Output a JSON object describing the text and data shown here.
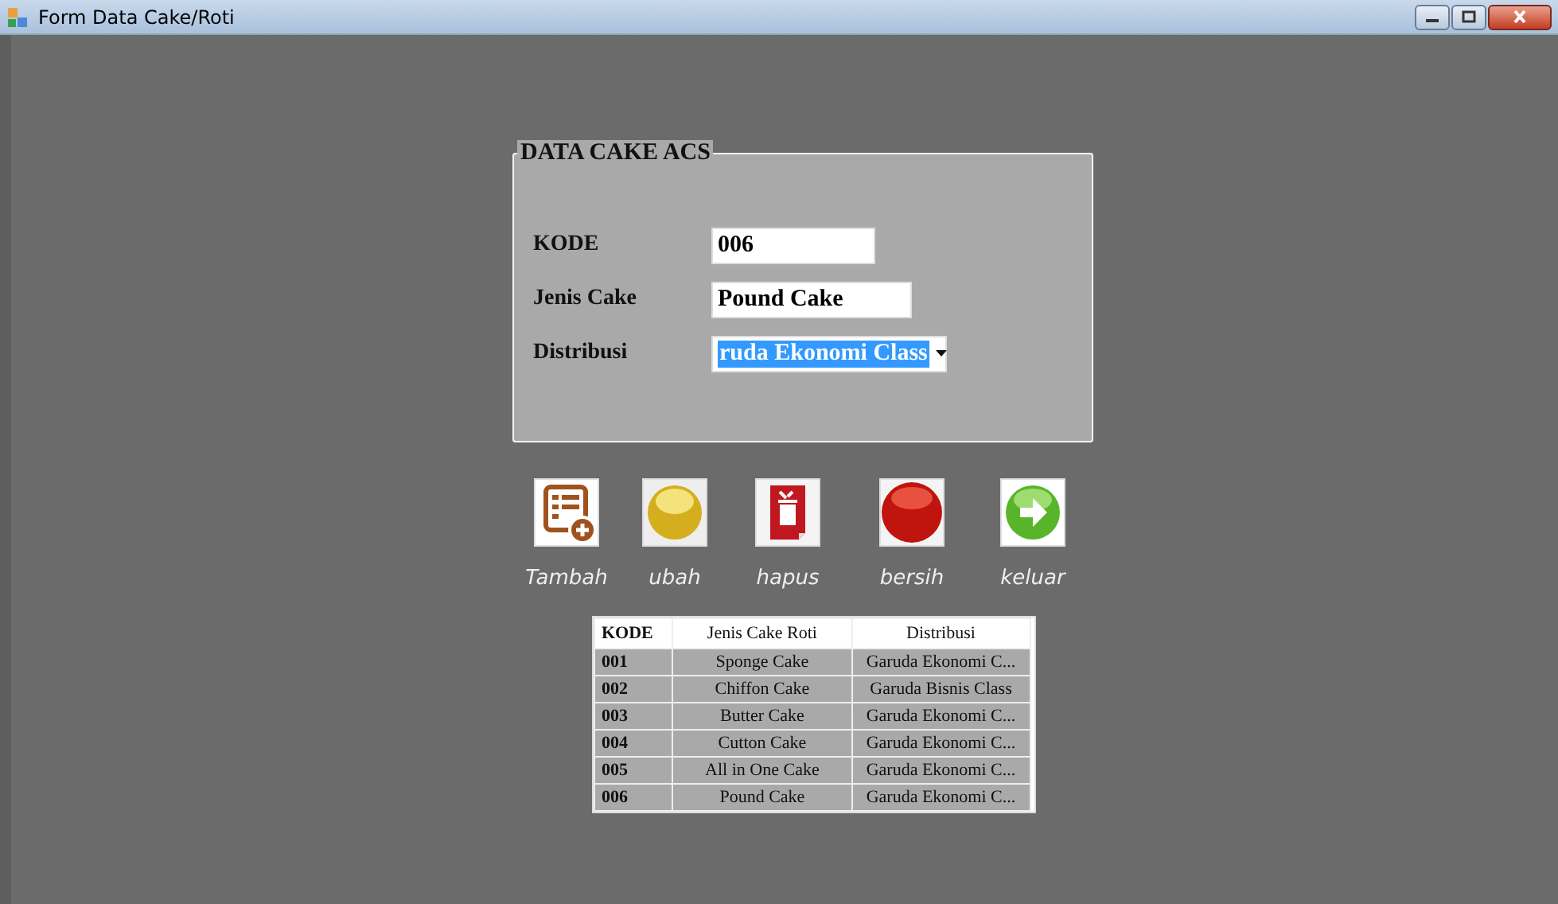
{
  "window": {
    "title": "Form Data Cake/Roti"
  },
  "form": {
    "title": "DATA CAKE ACS",
    "fields": [
      {
        "label": "KODE",
        "kind": "text",
        "value": "006"
      },
      {
        "label": "Jenis Cake",
        "kind": "text",
        "value": "Pound Cake"
      },
      {
        "label": "Distribusi",
        "kind": "dropdown",
        "value": "ruda Ekonomi Class",
        "selected": true
      }
    ]
  },
  "buttons": [
    {
      "label": "Tambah",
      "kind": "add"
    },
    {
      "label": "ubah",
      "kind": "edit"
    },
    {
      "label": "hapus",
      "kind": "delete"
    },
    {
      "label": "bersih",
      "kind": "clear"
    },
    {
      "label": "keluar",
      "kind": "exit"
    }
  ],
  "table": {
    "columns": [
      "KODE",
      "Jenis Cake Roti",
      "Distribusi"
    ],
    "rows": [
      [
        "001",
        "Sponge Cake",
        "Garuda Ekonomi C..."
      ],
      [
        "002",
        "Chiffon Cake",
        "Garuda Bisnis Class"
      ],
      [
        "003",
        "Butter Cake",
        "Garuda Ekonomi C..."
      ],
      [
        "004",
        "Cutton Cake",
        "Garuda Ekonomi C..."
      ],
      [
        "005",
        "All in One Cake",
        "Garuda Ekonomi C..."
      ],
      [
        "006",
        "Pound Cake",
        "Garuda Ekonomi C..."
      ]
    ]
  }
}
